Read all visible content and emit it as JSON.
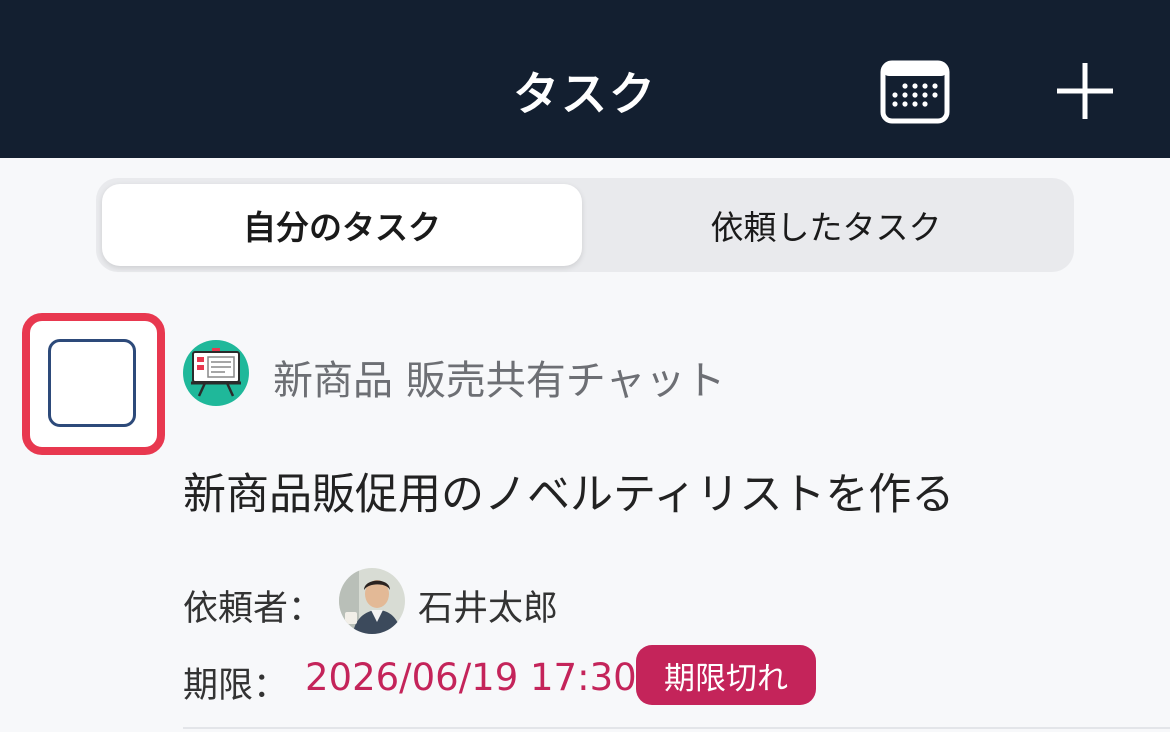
{
  "header": {
    "title": "タスク",
    "calendar_icon": "calendar-icon",
    "add_icon": "plus-icon"
  },
  "tabs": [
    {
      "label": "自分のタスク",
      "active": true
    },
    {
      "label": "依頼したタスク",
      "active": false
    }
  ],
  "task": {
    "checked": false,
    "chat_icon": "presentation-board-icon",
    "chat_name": "新商品 販売共有チャット",
    "title": "新商品販促用のノベルティリストを作る",
    "requester_label": "依頼者：",
    "requester_name": "石井太郎",
    "due_label": "期限：",
    "due_value": "2026/06/19 17:30",
    "overdue_badge": "期限切れ"
  },
  "colors": {
    "header_bg": "#131f30",
    "highlight": "#e8384f",
    "overdue": "#c4245a",
    "checkbox_border": "#2d4a7a"
  }
}
